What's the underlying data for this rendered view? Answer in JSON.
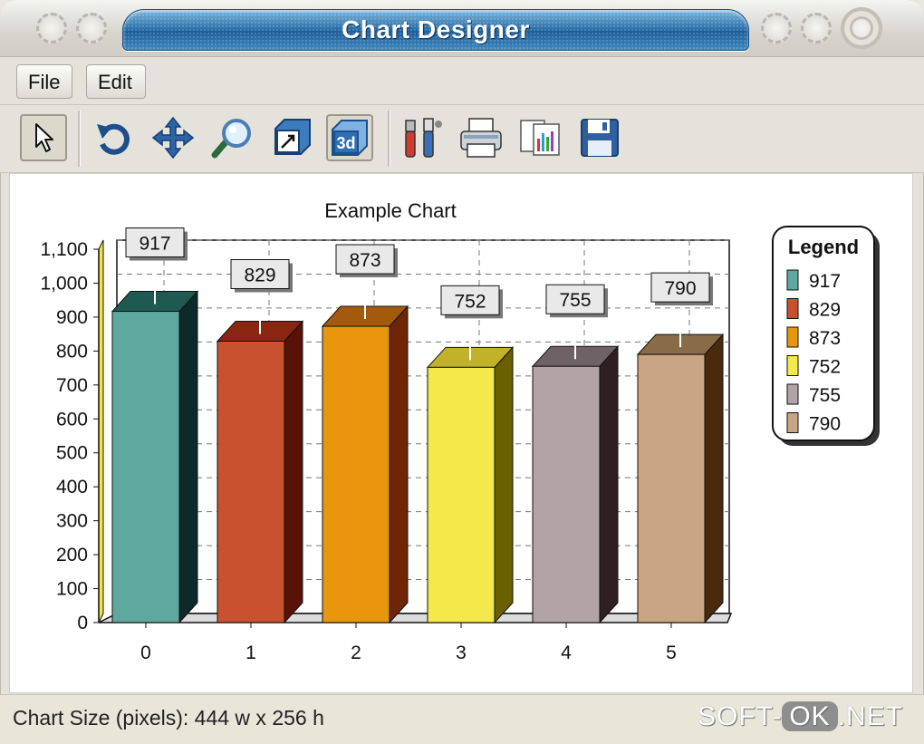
{
  "window": {
    "title": "Chart Designer"
  },
  "menu": {
    "file": "File",
    "edit": "Edit"
  },
  "toolbar": {
    "tools": [
      "pointer-icon",
      "rotate-icon",
      "move-icon",
      "zoom-icon",
      "resize-icon",
      "3d-view-icon",
      "properties-icon",
      "print-icon",
      "copy-icon",
      "save-icon"
    ],
    "three_d_label": "3d"
  },
  "status": {
    "text": "Chart Size (pixels): 444 w  x  256 h"
  },
  "watermark": {
    "left": "SOFT-",
    "ok": "OK",
    "right": ".NET"
  },
  "chart_data": {
    "type": "bar",
    "title": "Example Chart",
    "categories": [
      "0",
      "1",
      "2",
      "3",
      "4",
      "5"
    ],
    "values": [
      917,
      829,
      873,
      752,
      755,
      790
    ],
    "ylim": [
      0,
      1100
    ],
    "yticks": [
      "0",
      "100",
      "200",
      "300",
      "400",
      "500",
      "600",
      "700",
      "800",
      "900",
      "1,000",
      "1,100"
    ],
    "grid": true,
    "legend": {
      "title": "Legend",
      "placement": "right",
      "entries": [
        "917",
        "829",
        "873",
        "752",
        "755",
        "790"
      ]
    },
    "colors": [
      "#5fa8a0",
      "#c8512f",
      "#e8960e",
      "#f5e84a",
      "#b1a3a6",
      "#c9a584"
    ],
    "side_colors": [
      "#0e2a28",
      "#5a1208",
      "#6e2607",
      "#6a6000",
      "#2d1f22",
      "#4a2a0c"
    ],
    "top_colors": [
      "#1f5a52",
      "#8a2610",
      "#a45a0a",
      "#c2b12a",
      "#6f6266",
      "#8a6b48"
    ]
  }
}
